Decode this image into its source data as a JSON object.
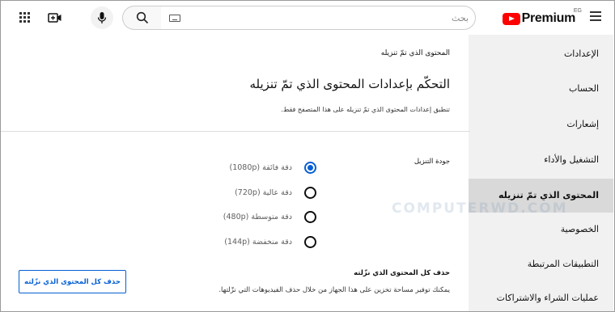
{
  "header": {
    "logo_text": "Premium",
    "region": "EG",
    "search_placeholder": "بحث",
    "icons": {
      "menu": "hamburger-icon",
      "keyboard": "keyboard-icon",
      "search": "search-icon",
      "mic": "microphone-icon",
      "create": "create-video-icon",
      "apps": "apps-grid-icon"
    },
    "brand_color": "#ff0000"
  },
  "sidebar": {
    "items": [
      {
        "label": "الإعدادات"
      },
      {
        "label": "الحساب"
      },
      {
        "label": "إشعارات"
      },
      {
        "label": "التشغيل والأداء"
      },
      {
        "label": "المحتوى الذي تمّ تنزيله",
        "active": true
      },
      {
        "label": "الخصوصية"
      },
      {
        "label": "التطبيقات المرتبطة"
      },
      {
        "label": "عمليات الشراء والاشتراكات"
      }
    ]
  },
  "main": {
    "breadcrumb": "المحتوى الذي تمّ تنزيله",
    "title": "التحكّم بإعدادات المحتوى الذي تمّ تنزيله",
    "subtitle": "تنطبق إعدادات المحتوى الذي تمّ تنزيله على هذا المتصفح فقط.",
    "quality_label": "جودة التنزيل",
    "quality_options": [
      {
        "label": "دقة فائقة (1080p)",
        "selected": true
      },
      {
        "label": "دقة عالية (720p)",
        "selected": false
      },
      {
        "label": "دقة متوسطة (480p)",
        "selected": false
      },
      {
        "label": "دقة منخفضة (144p)",
        "selected": false
      }
    ],
    "delete_title": "حذف كل المحتوى الذي نزّلته",
    "delete_desc": "يمكنك توفير مساحة تخزين على هذا الجهاز من خلال حذف الفيديوهات التي نزّلتها.",
    "delete_button": "حذف كل المحتوى الذي نزّلته"
  },
  "watermark": "COMPUTERWD.COM",
  "accent_color": "#065fd4"
}
